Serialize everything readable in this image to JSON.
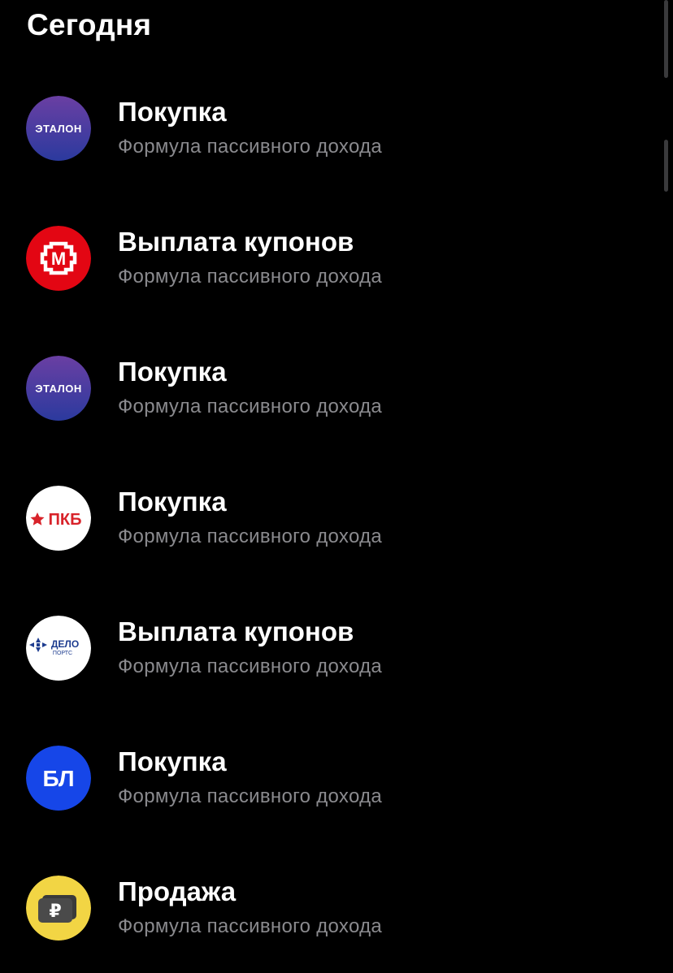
{
  "section": {
    "title": "Сегодня"
  },
  "operations": [
    {
      "title": "Покупка",
      "subtitle": "Формула пассивного дохода",
      "icon": "etalon-logo-icon",
      "logo_text": "ЭТАЛОН"
    },
    {
      "title": "Выплата купонов",
      "subtitle": "Формула пассивного дохода",
      "icon": "magnit-logo-icon",
      "logo_text": "М"
    },
    {
      "title": "Покупка",
      "subtitle": "Формула пассивного дохода",
      "icon": "etalon-logo-icon",
      "logo_text": "ЭТАЛОН"
    },
    {
      "title": "Покупка",
      "subtitle": "Формула пассивного дохода",
      "icon": "pkb-logo-icon",
      "logo_text": "ПКБ"
    },
    {
      "title": "Выплата купонов",
      "subtitle": "Формула пассивного дохода",
      "icon": "delo-ports-logo-icon",
      "logo_text": "ДЕЛО",
      "logo_subtext": "ПОРТС"
    },
    {
      "title": "Покупка",
      "subtitle": "Формула пассивного дохода",
      "icon": "bl-logo-icon",
      "logo_text": "БЛ"
    },
    {
      "title": "Продажа",
      "subtitle": "Формула пассивного дохода",
      "icon": "ruble-money-icon",
      "logo_text": "₽"
    }
  ],
  "colors": {
    "background": "#000000",
    "title": "#ffffff",
    "subtitle": "#8a8a8e",
    "etalon_start": "#5b3fa8",
    "etalon_end": "#2c3e9c",
    "magnit_red": "#e30613",
    "pkb_red": "#d8232a",
    "delo_blue": "#1d3c8f",
    "bl_blue": "#1646e8",
    "ruble_yellow": "#f2d544"
  }
}
